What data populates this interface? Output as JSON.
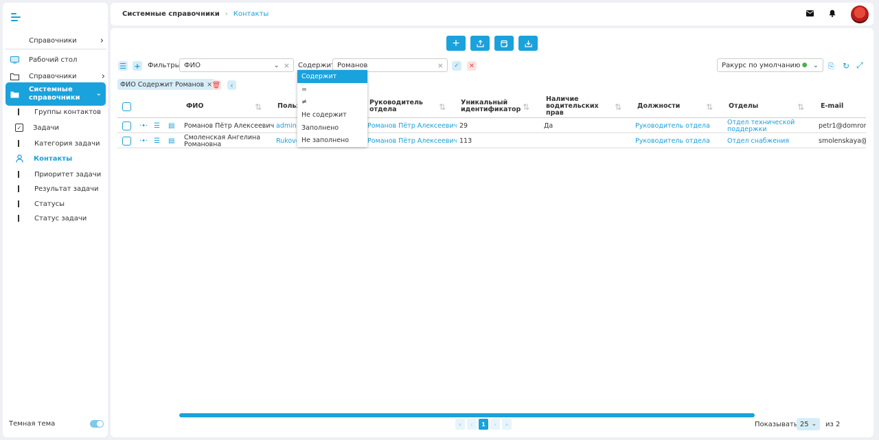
{
  "sidebar": {
    "section_title": "Справочники",
    "items": [
      {
        "label": "Рабочий стол"
      },
      {
        "label": "Справочники"
      },
      {
        "label": "Системные справочники"
      }
    ],
    "subitems": [
      {
        "label": "Группы контактов"
      },
      {
        "label": "Задачи"
      },
      {
        "label": "Категория задачи"
      },
      {
        "label": "Контакты"
      },
      {
        "label": "Приоритет задачи"
      },
      {
        "label": "Результат задачи"
      },
      {
        "label": "Статусы"
      },
      {
        "label": "Статус задачи"
      }
    ],
    "theme_label": "Темная тема"
  },
  "header": {
    "breadcrumb_parent": "Системные справочники",
    "breadcrumb_current": "Контакты"
  },
  "filters": {
    "label": "Фильтры",
    "field_value": "ФИО",
    "operator_label": "Содержит",
    "search_value": "Романов",
    "view_value": "Ракурс по умолчанию",
    "chip": "ФИО Содержит Романов"
  },
  "operator_menu": [
    "Содержит",
    "=",
    "≠",
    "Не содержит",
    "Заполнено",
    "Не заполнено"
  ],
  "table": {
    "columns": {
      "fio": "ФИО",
      "user": "Польз",
      "manager": "Руководитель отдела",
      "uid": "Уникальный идентификатор",
      "license": "Наличие водительских прав",
      "positions": "Должности",
      "departments": "Отделы",
      "email": "E-mail"
    },
    "rows": [
      {
        "fio": "Романов Пётр Алексеевич",
        "user": "admin",
        "manager": "Романов Пётр Алексеевич",
        "uid": "29",
        "license": "Да",
        "position": "Руководитель отдела",
        "department": "Отдел технической поддержки",
        "email": "petr1@domrom"
      },
      {
        "fio": "Смоленская Ангелина Романовна",
        "user": "Rukovo",
        "manager": "Романов Пётр Алексеевич",
        "uid": "113",
        "license": "",
        "position": "Руководитель отдела",
        "department": "Отдел снабжения",
        "email": "smolenskaya@n"
      }
    ]
  },
  "footer": {
    "current_page": "1",
    "show_label": "Показывать",
    "per_page": "25",
    "of_label": "из 2"
  },
  "colors": {
    "accent": "#1aa2dc",
    "danger": "#e04848"
  }
}
